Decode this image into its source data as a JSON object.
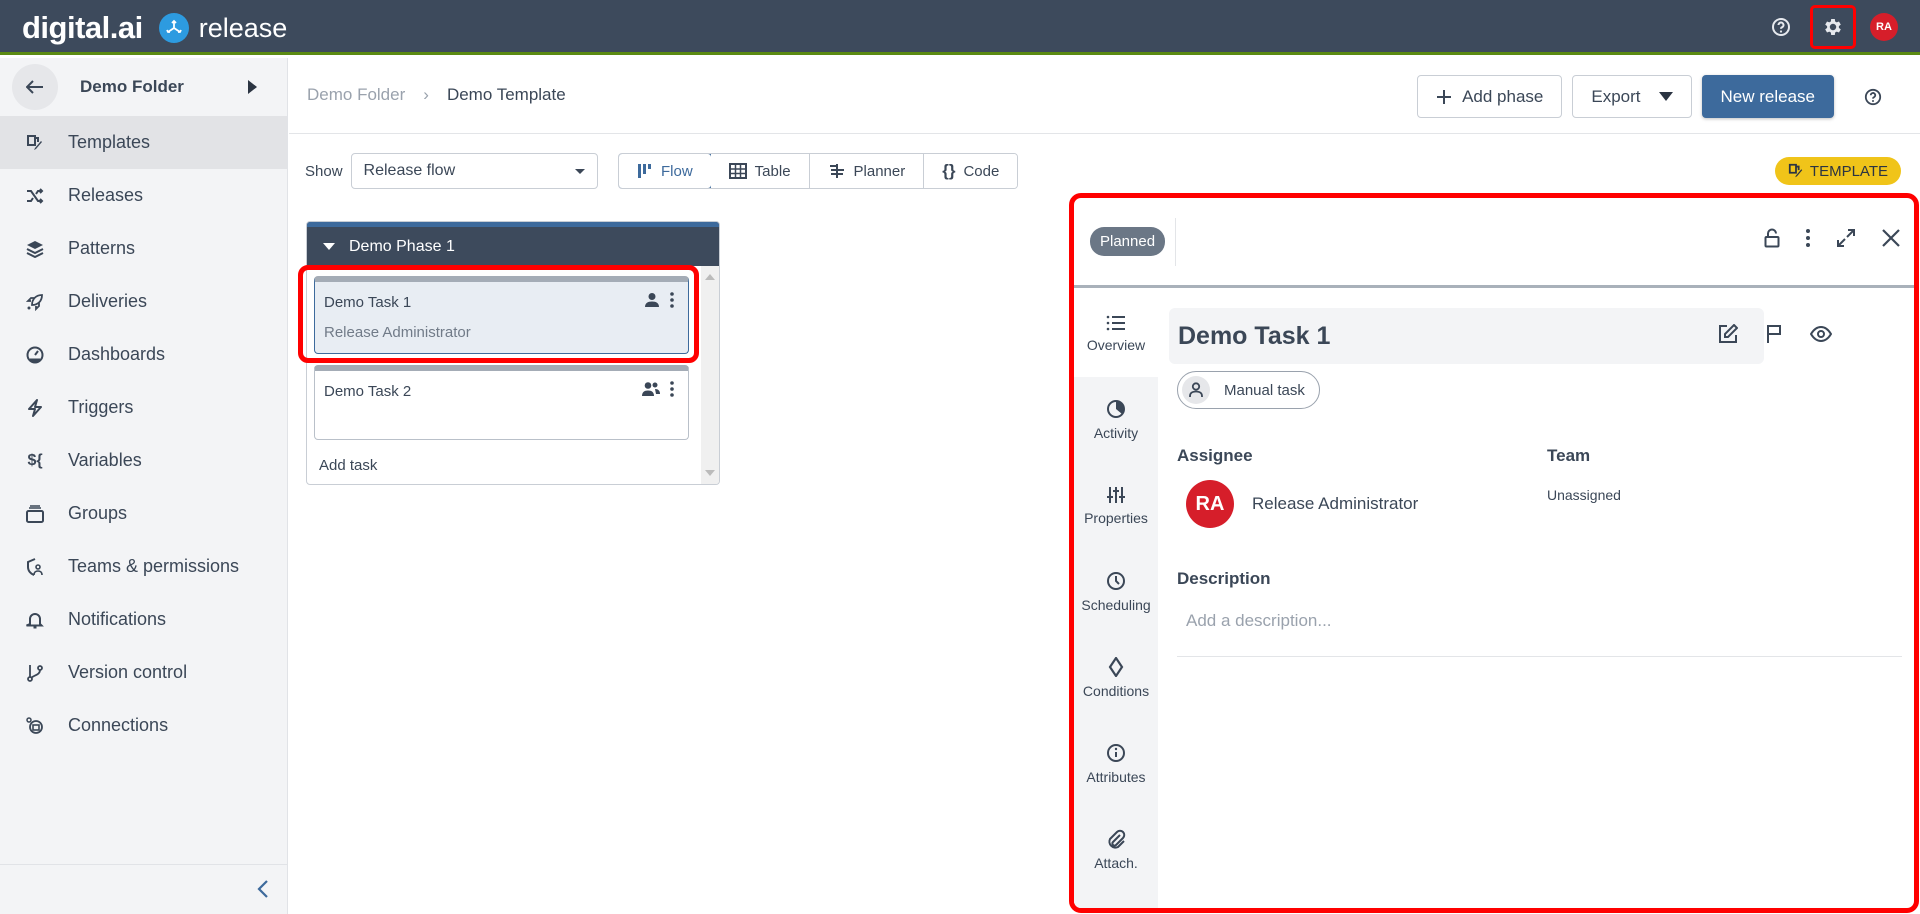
{
  "topbar": {
    "brand": "digital.ai",
    "product": "release",
    "help_icon": "help-circle-icon",
    "settings_icon": "gear-icon",
    "user_initials": "RA"
  },
  "sidebar": {
    "folder": "Demo Folder",
    "items": [
      {
        "label": "Templates",
        "icon": "templates-icon",
        "active": true
      },
      {
        "label": "Releases",
        "icon": "shuffle-icon"
      },
      {
        "label": "Patterns",
        "icon": "layers-icon"
      },
      {
        "label": "Deliveries",
        "icon": "rocket-icon"
      },
      {
        "label": "Dashboards",
        "icon": "dashboard-icon"
      },
      {
        "label": "Triggers",
        "icon": "bolt-icon"
      },
      {
        "label": "Variables",
        "icon": "variables-icon",
        "glyph": "${"
      },
      {
        "label": "Groups",
        "icon": "groups-icon"
      },
      {
        "label": "Teams & permissions",
        "icon": "shield-user-icon"
      },
      {
        "label": "Notifications",
        "icon": "bell-icon"
      },
      {
        "label": "Version control",
        "icon": "branch-icon"
      },
      {
        "label": "Connections",
        "icon": "plug-icon"
      }
    ]
  },
  "breadcrumb": {
    "parent": "Demo Folder",
    "separator": "›",
    "current": "Demo Template"
  },
  "header": {
    "add_phase": "Add phase",
    "export": "Export",
    "new_release": "New release"
  },
  "toolbar": {
    "show_label": "Show",
    "show_value": "Release flow",
    "views": [
      "Flow",
      "Table",
      "Planner",
      "Code"
    ],
    "active_view": "Flow",
    "badge": "TEMPLATE"
  },
  "phase": {
    "name": "Demo Phase 1",
    "tasks": [
      {
        "name": "Demo Task 1",
        "assignee": "Release Administrator"
      },
      {
        "name": "Demo Task 2",
        "assignee": ""
      }
    ],
    "add_task": "Add task"
  },
  "details": {
    "status": "Planned",
    "tabs": [
      "Overview",
      "Activity",
      "Properties",
      "Scheduling",
      "Conditions",
      "Attributes",
      "Attach."
    ],
    "title": "Demo Task 1",
    "task_type": "Manual task",
    "assignee_label": "Assignee",
    "assignee_initials": "RA",
    "assignee_name": "Release Administrator",
    "team_label": "Team",
    "team_value": "Unassigned",
    "description_label": "Description",
    "description_placeholder": "Add a description..."
  },
  "colors": {
    "topbar": "#3d4a5c",
    "accent_green": "#5b8a12",
    "primary": "#3d6a9c",
    "avatar_red": "#d61e2a",
    "template_badge": "#f0c419",
    "highlight": "#ff0000"
  }
}
